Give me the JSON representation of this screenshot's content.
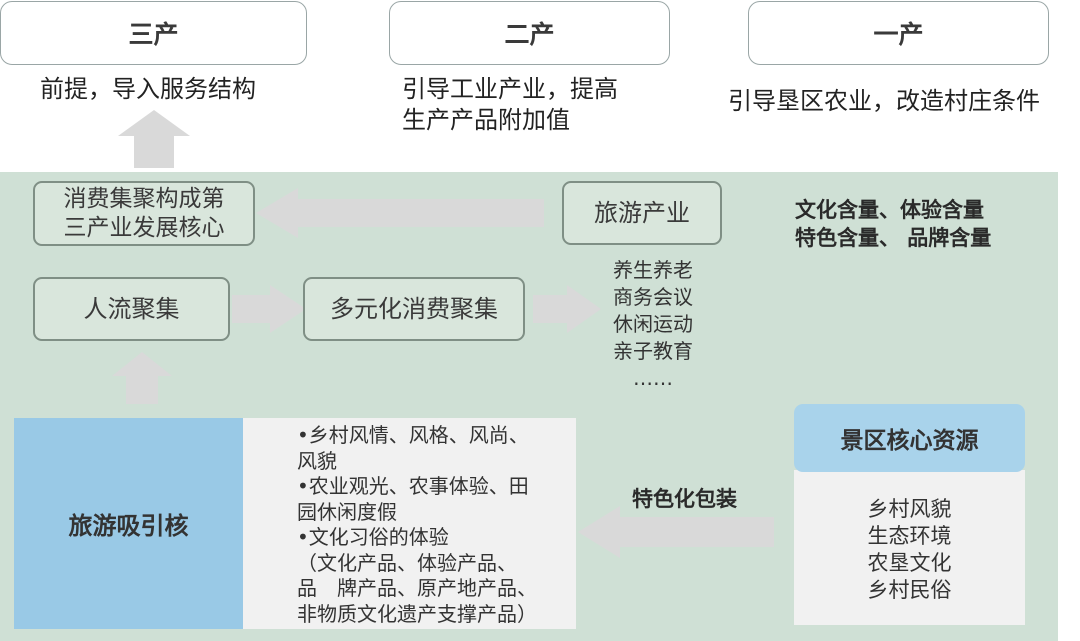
{
  "top": {
    "tertiary": {
      "label": "三产",
      "desc": "前提，导入服务结构"
    },
    "secondary": {
      "label": "二产",
      "desc_line1": "引导工业产业，提高",
      "desc_line2": "生产产品附加值"
    },
    "primary": {
      "label": "一产",
      "desc": "引导垦区农业，改造村庄条件"
    }
  },
  "flow": {
    "consumption_core_line1": "消费集聚构成第",
    "consumption_core_line2": "三产业发展核心",
    "tourism_industry": "旅游产业",
    "content_note_line1": "文化含量、体验含量",
    "content_note_line2": "特色含量、 品牌含量",
    "people_flow": "人流聚集",
    "diverse_consumption": "多元化消费聚集",
    "activities": [
      "养生养老",
      "商务会议",
      "休闲运动",
      "亲子教育",
      "……"
    ]
  },
  "attraction": {
    "title": "旅游吸引核",
    "lines": [
      "•乡村风情、风格、风尚、",
      "风貌",
      "•农业观光、农事体验、田",
      "园休闲度假",
      "•文化习俗的体验",
      "（文化产品、体验产品、",
      "品　牌产品、原产地产品、",
      "非物质文化遗产支撑产品）"
    ]
  },
  "packaging_label": "特色化包装",
  "resources": {
    "title": "景区核心资源",
    "items": [
      "乡村风貌",
      "生态环境",
      "农垦文化",
      "乡村民俗"
    ]
  },
  "colors": {
    "panel_green": "#cfe0d5",
    "arrow_grey": "#d9d9d9",
    "attraction_blue": "#99c9e6",
    "resource_blue": "#a9d3eb"
  }
}
